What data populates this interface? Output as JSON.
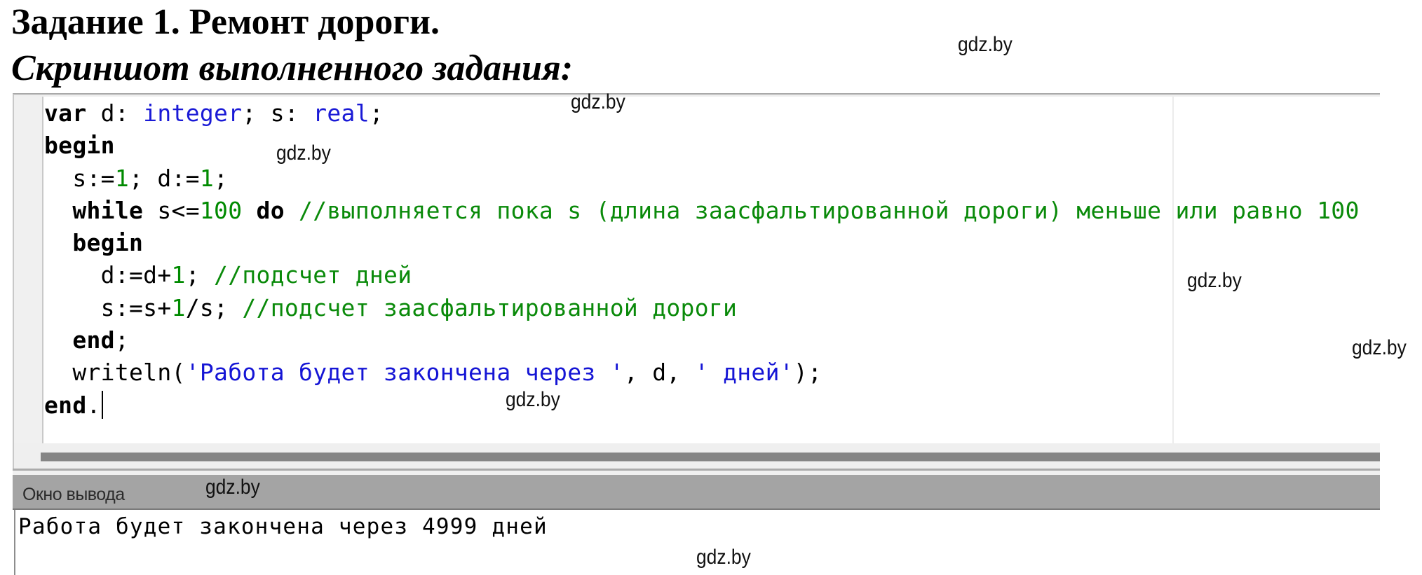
{
  "heading": {
    "task_label": "Задание 1.",
    "task_title": " Ремонт дороги.",
    "subtitle": "Скриншот выполненного задания:"
  },
  "editor": {
    "lines": [
      [
        {
          "t": "var",
          "c": "kw-plain"
        },
        {
          "t": " d: ",
          "c": "plain"
        },
        {
          "t": "integer",
          "c": "ty"
        },
        {
          "t": "; s: ",
          "c": "plain"
        },
        {
          "t": "real",
          "c": "ty"
        },
        {
          "t": ";",
          "c": "plain"
        }
      ],
      [
        {
          "t": "begin",
          "c": "kw"
        }
      ],
      [
        {
          "t": "  s:=",
          "c": "plain"
        },
        {
          "t": "1",
          "c": "num"
        },
        {
          "t": "; d:=",
          "c": "plain"
        },
        {
          "t": "1",
          "c": "num"
        },
        {
          "t": ";",
          "c": "plain"
        }
      ],
      [
        {
          "t": "  while",
          "c": "kw"
        },
        {
          "t": " s<=",
          "c": "plain"
        },
        {
          "t": "100",
          "c": "num"
        },
        {
          "t": " ",
          "c": "plain"
        },
        {
          "t": "do",
          "c": "kw"
        },
        {
          "t": " //выполняется пока s (длина заасфальтированной дороги) меньше или равно 100",
          "c": "cm"
        }
      ],
      [
        {
          "t": "  begin",
          "c": "kw"
        }
      ],
      [
        {
          "t": "    d:=d+",
          "c": "plain"
        },
        {
          "t": "1",
          "c": "num"
        },
        {
          "t": "; ",
          "c": "plain"
        },
        {
          "t": "//подсчет дней",
          "c": "cm"
        }
      ],
      [
        {
          "t": "    s:=s+",
          "c": "plain"
        },
        {
          "t": "1",
          "c": "num"
        },
        {
          "t": "/s; ",
          "c": "plain"
        },
        {
          "t": "//подсчет заасфальтированной дороги",
          "c": "cm"
        }
      ],
      [
        {
          "t": "  end",
          "c": "kw"
        },
        {
          "t": ";",
          "c": "plain"
        }
      ],
      [
        {
          "t": "  writeln(",
          "c": "plain"
        },
        {
          "t": "'Работа будет закончена через '",
          "c": "str"
        },
        {
          "t": ", d, ",
          "c": "plain"
        },
        {
          "t": "' дней'",
          "c": "str"
        },
        {
          "t": ");",
          "c": "plain"
        }
      ],
      [
        {
          "t": "end",
          "c": "kw"
        },
        {
          "t": ".",
          "c": "plain"
        }
      ]
    ],
    "colors": {
      "keyword": "#000000",
      "type": "#1a1ad6",
      "number": "#008a00",
      "comment": "#0a8a0a",
      "string": "#1515d5"
    }
  },
  "output_panel": {
    "title": "Окно вывода",
    "text": "Работа будет закончена через 4999 дней"
  },
  "watermark": {
    "text": "gdz.by",
    "count": 8
  }
}
